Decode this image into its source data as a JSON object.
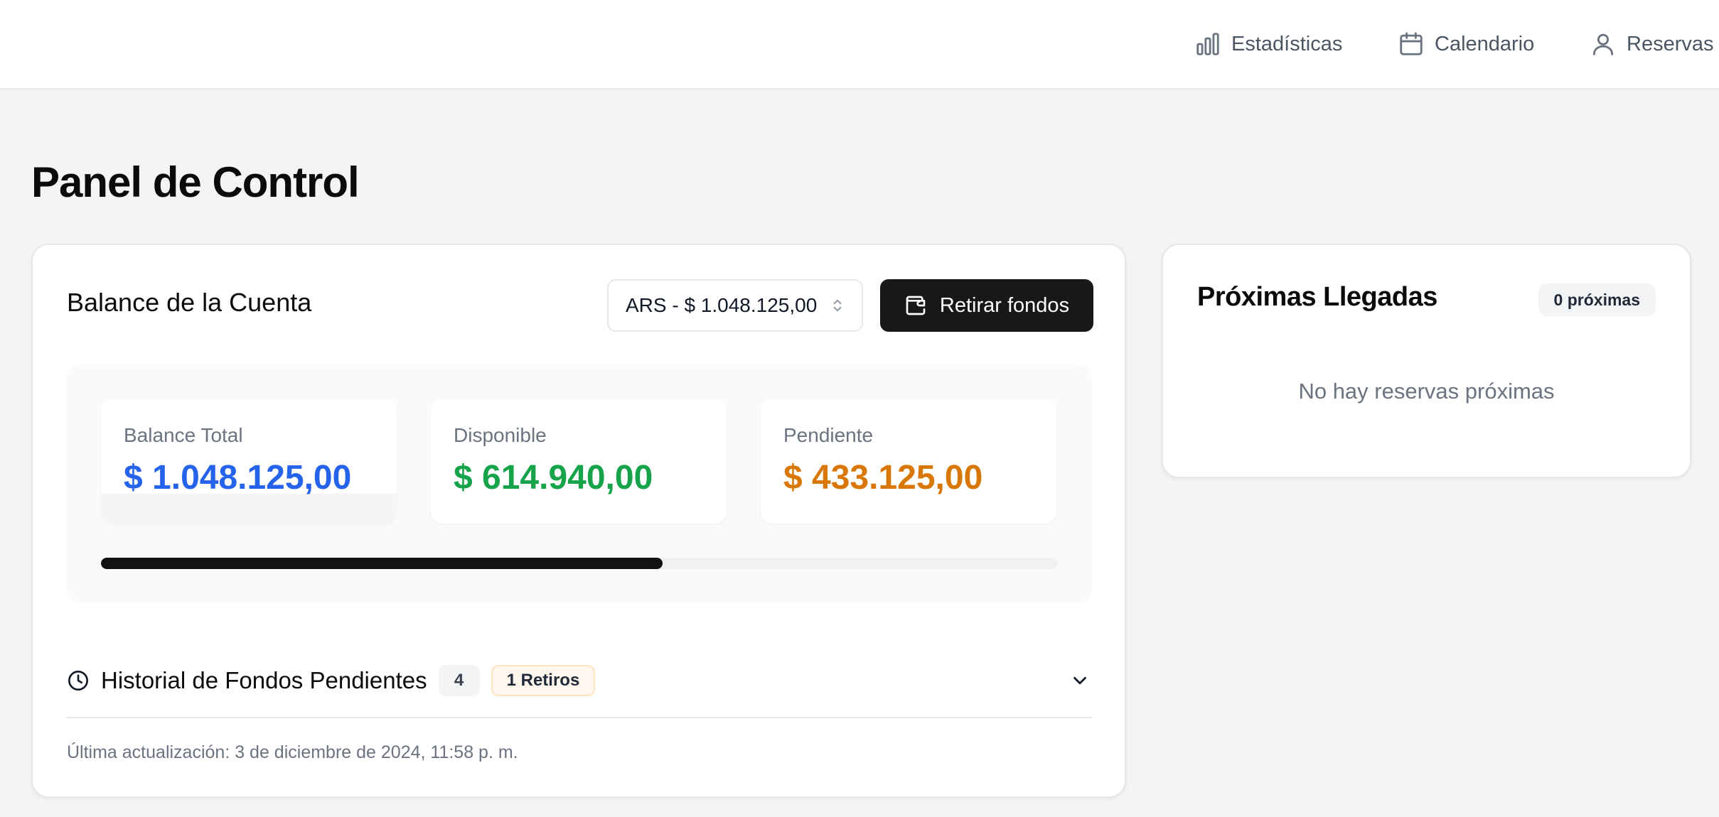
{
  "nav": {
    "items": [
      {
        "label": "Estadísticas",
        "icon": "bar-chart-icon"
      },
      {
        "label": "Calendario",
        "icon": "calendar-icon"
      },
      {
        "label": "Reservas",
        "icon": "user-icon"
      }
    ]
  },
  "page": {
    "title": "Panel de Control"
  },
  "balance": {
    "title": "Balance de la Cuenta",
    "currency_selected": "ARS - $ 1.048.125,00",
    "withdraw_label": "Retirar fondos",
    "stats": [
      {
        "label": "Balance Total",
        "value": "$ 1.048.125,00",
        "color": "#2563eb"
      },
      {
        "label": "Disponible",
        "value": "$ 614.940,00",
        "color": "#16a34a"
      },
      {
        "label": "Pendiente",
        "value": "$ 433.125,00",
        "color": "#d97706"
      }
    ],
    "available_fraction": 0.587
  },
  "history": {
    "title": "Historial de Fondos Pendientes",
    "count": "4",
    "retiros_badge": "1 Retiros",
    "last_updated": "Última actualización: 3 de diciembre de 2024, 11:58 p. m."
  },
  "arrivals": {
    "title": "Próximas Llegadas",
    "badge": "0 próximas",
    "empty_text": "No hay reservas próximas"
  }
}
